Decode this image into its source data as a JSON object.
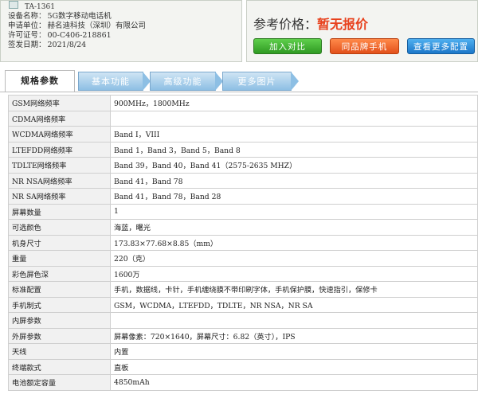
{
  "device_info": {
    "model": "TA-1361",
    "rows": [
      {
        "label": "设备名称：",
        "value": "5G数字移动电话机"
      },
      {
        "label": "申请单位：",
        "value": "赫名迪科技（深圳）有限公司"
      },
      {
        "label": "许可证号：",
        "value": "00-C406-218861"
      },
      {
        "label": "签发日期：",
        "value": "2021/8/24"
      }
    ]
  },
  "price": {
    "label": "参考价格：",
    "value": "暂无报价"
  },
  "buttons": {
    "compare": "加入对比",
    "same_brand": "同品牌手机",
    "more_specs": "查看更多配置"
  },
  "tabs": [
    {
      "label": "规格参数",
      "active": true
    },
    {
      "label": "基本功能",
      "active": false
    },
    {
      "label": "高级功能",
      "active": false
    },
    {
      "label": "更多图片",
      "active": false
    }
  ],
  "specs": [
    {
      "key": "GSM网络频率",
      "value": "900MHz，1800MHz"
    },
    {
      "key": "CDMA网络频率",
      "value": ""
    },
    {
      "key": "WCDMA网络频率",
      "value": "Band Ⅰ，VIII"
    },
    {
      "key": "LTEFDD网络频率",
      "value": "Band 1，Band 3，Band 5，Band 8"
    },
    {
      "key": "TDLTE网络频率",
      "value": "Band 39，Band 40，Band 41（2575-2635 MHZ）"
    },
    {
      "key": "NR NSA网络频率",
      "value": "Band 41，Band 78"
    },
    {
      "key": "NR SA网络频率",
      "value": "Band 41，Band 78，Band 28"
    },
    {
      "key": "屏幕数量",
      "value": "1"
    },
    {
      "key": "可选颜色",
      "value": "海蓝，曙光"
    },
    {
      "key": "机身尺寸",
      "value": "173.83×77.68×8.85（mm）"
    },
    {
      "key": "重量",
      "value": "220（克）"
    },
    {
      "key": "彩色屏色深",
      "value": "1600万"
    },
    {
      "key": "标准配置",
      "value": "手机，数据线，卡针，手机缠绕膜不带印刷字体，手机保护膜，快速指引，保修卡"
    },
    {
      "key": "手机制式",
      "value": "GSM，WCDMA，LTEFDD，TDLTE，NR NSA，NR SA"
    },
    {
      "key": "内屏参数",
      "value": ""
    },
    {
      "key": "外屏参数",
      "value": "屏幕像素：720×1640，屏幕尺寸：6.82（英寸），IPS"
    },
    {
      "key": "天线",
      "value": "内置"
    },
    {
      "key": "终端款式",
      "value": "直板"
    },
    {
      "key": "电池额定容量",
      "value": "4850mAh"
    }
  ]
}
